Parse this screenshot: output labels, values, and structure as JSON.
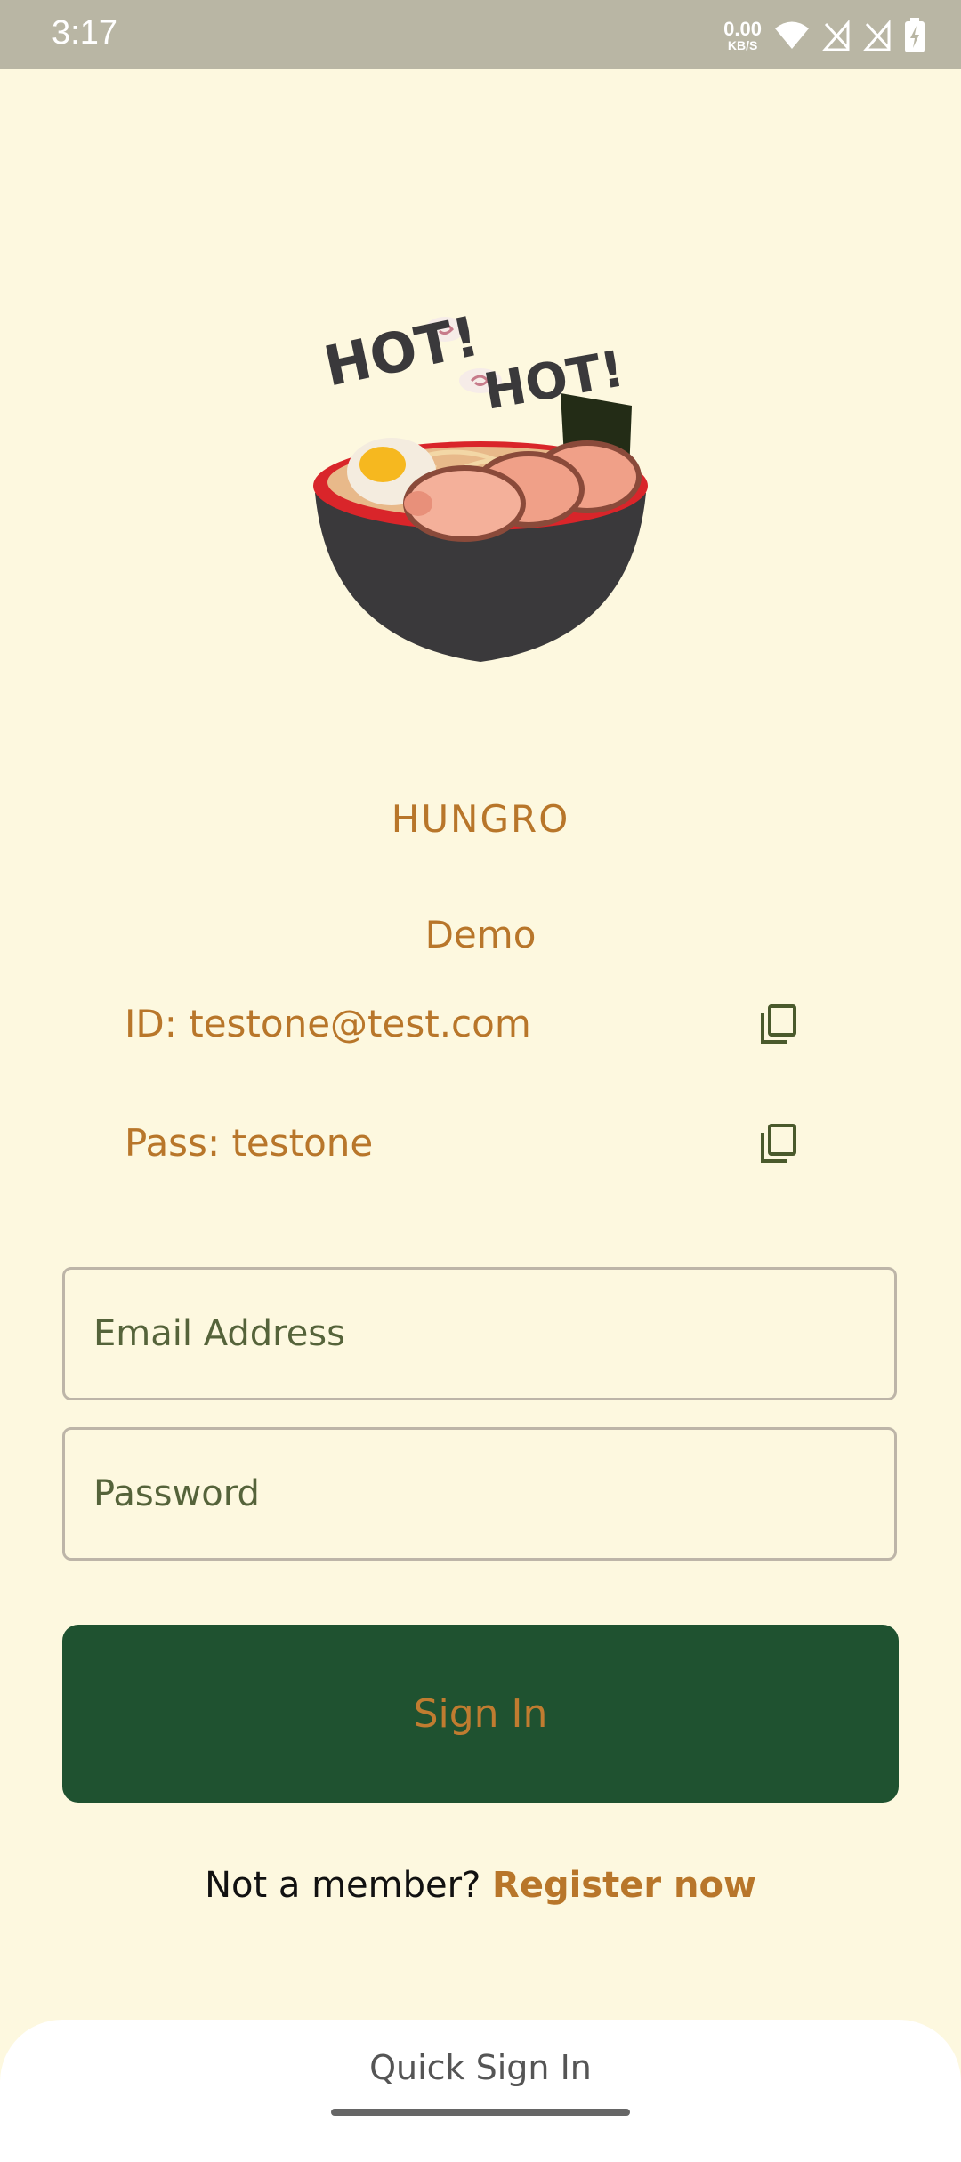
{
  "status_bar": {
    "time": "3:17",
    "net_speed_value": "0.00",
    "net_speed_unit": "KB/S",
    "icons": [
      "wifi-icon",
      "no-sim-icon",
      "no-sim-icon",
      "battery-charging-icon"
    ]
  },
  "logo": {
    "text_left": "HOT!",
    "text_right": "HOT!"
  },
  "app": {
    "name": "HUNGRO"
  },
  "demo": {
    "heading": "Demo",
    "id_text": "ID: testone@test.com",
    "pass_text": "Pass: testone",
    "copy_icon": "copy-icon"
  },
  "form": {
    "email_placeholder": "Email Address",
    "email_value": "",
    "password_placeholder": "Password",
    "password_value": "",
    "signin_label": "Sign In"
  },
  "register": {
    "prompt": "Not a member? ",
    "link": "Register now"
  },
  "quick_sign_in": {
    "label": "Quick Sign In"
  },
  "colors": {
    "background": "#fdf8df",
    "accent": "#b8762a",
    "button": "#1f5230",
    "status_bar": "#b9b6a4"
  }
}
